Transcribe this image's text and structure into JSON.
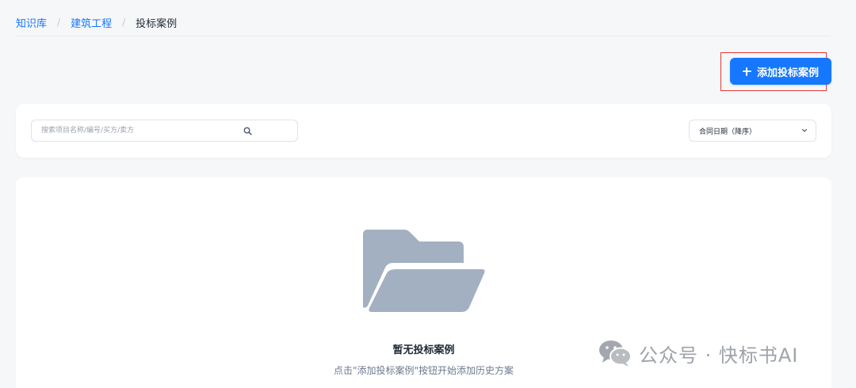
{
  "breadcrumb": {
    "items": [
      "知识库",
      "建筑工程"
    ],
    "separator": "/",
    "current": "投标案例"
  },
  "toolbar": {
    "add_label": "添加投标案例",
    "add_icon": "plus-icon",
    "highlight_color": "#e53935",
    "accent_color": "#1677ff"
  },
  "filters": {
    "search_placeholder": "搜索项目名称/编号/买方/卖方",
    "search_value": "",
    "search_icon": "search-icon",
    "sort_selected": "合同日期（降序）",
    "sort_icon": "chevron-down-icon"
  },
  "empty_state": {
    "icon": "folder-open-icon",
    "title": "暂无投标案例",
    "hint": "点击\"添加投标案例\"按钮开始添加历史方案"
  },
  "watermark": {
    "icon": "wechat-icon",
    "text": "公众号 · 快标书AI"
  }
}
